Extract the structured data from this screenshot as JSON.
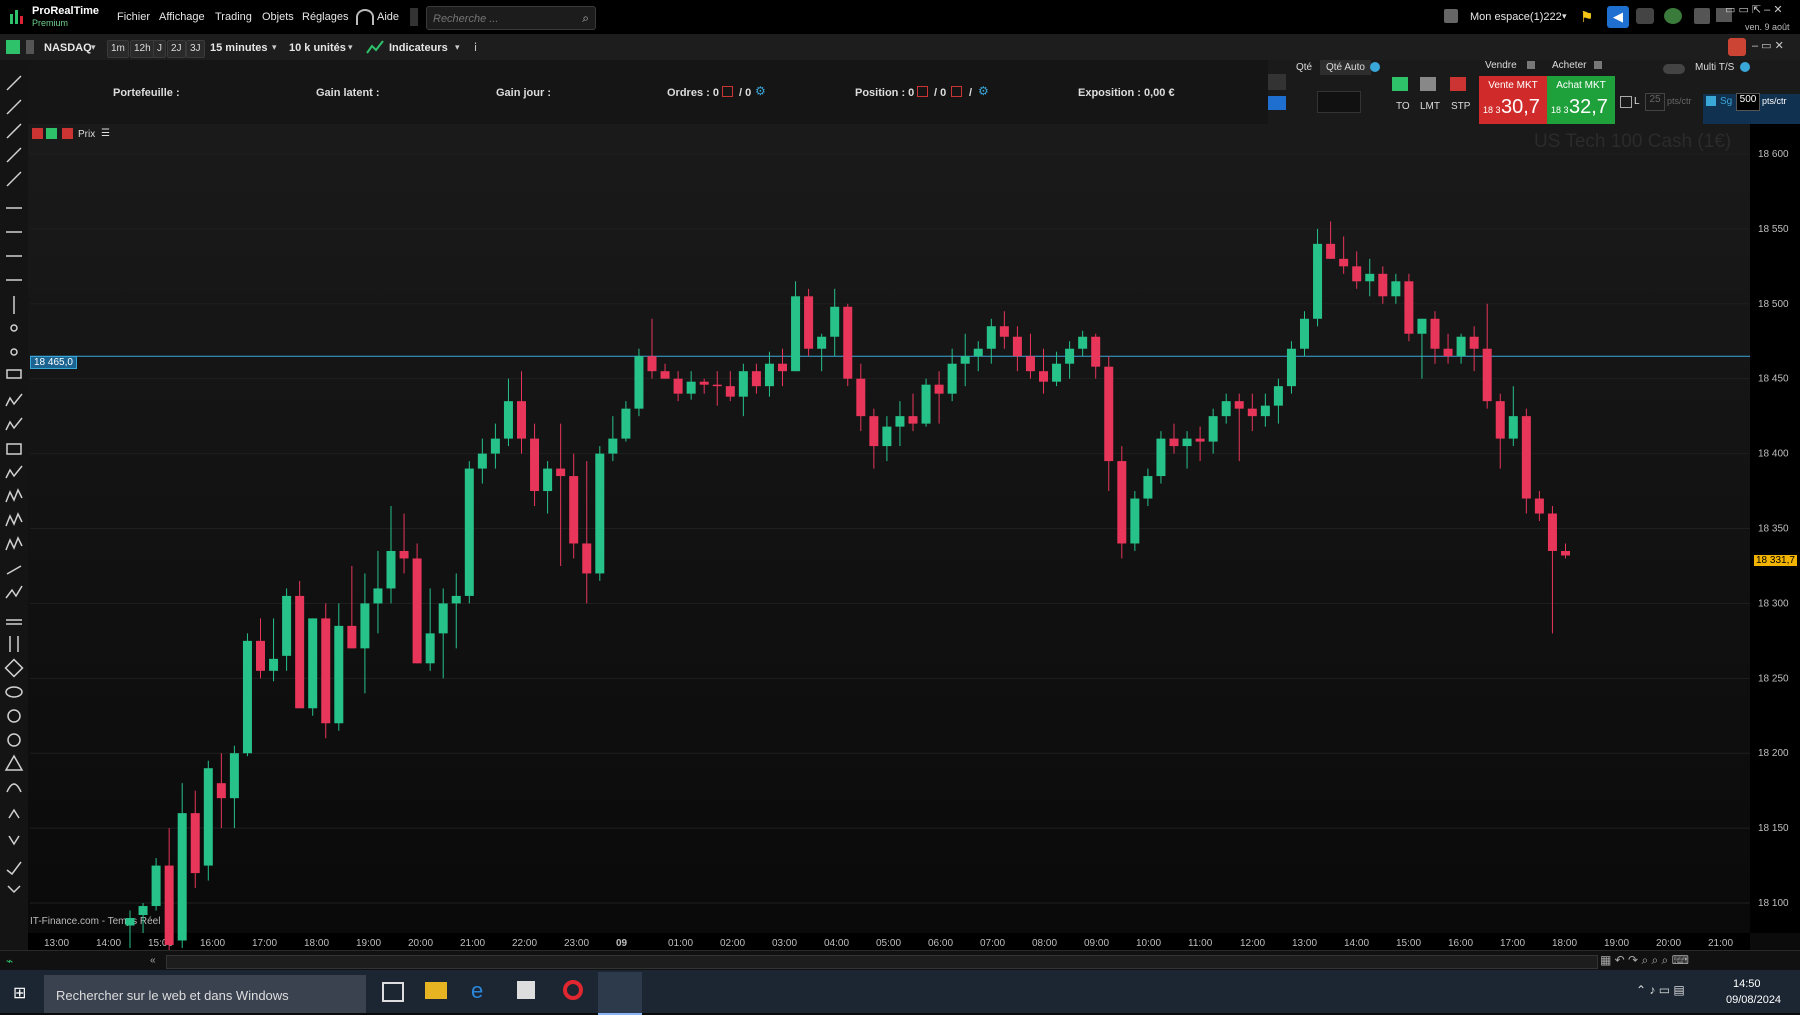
{
  "app": {
    "title": "ProRealTime",
    "subtitle": "Premium"
  },
  "menu": [
    "Fichier",
    "Affichage",
    "Trading",
    "Objets",
    "Réglages"
  ],
  "help_label": "Aide",
  "search": {
    "placeholder": "Recherche ..."
  },
  "workspace_label": "Mon espace(1)222",
  "date_top": "ven. 9 août",
  "toolbar": {
    "instrument": "NASDAQ",
    "periods": [
      "1m",
      "12h",
      "J",
      "2J",
      "3J"
    ],
    "timeframe": "15 minutes",
    "units": "10 k unités",
    "indicators_label": "Indicateurs"
  },
  "info": {
    "portefeuille": "Portefeuille :",
    "gain_latent": "Gain latent :",
    "gain_jour": "Gain jour :",
    "ordres": "Ordres : 0",
    "ordres_b": "/ 0",
    "position": "Position : 0",
    "position_b": "/ 0",
    "position_c": "/",
    "exposition": "Exposition : 0,00 €"
  },
  "trade": {
    "qty_label": "Qté",
    "qty_auto": "Qté Auto",
    "order_types": [
      "TO",
      "LMT",
      "STP"
    ],
    "sell_header": "Vendre",
    "buy_header": "Acheter",
    "sell_label": "Vente MKT",
    "buy_label": "Achat MKT",
    "sell_prefix": "18 3",
    "sell_price": "30,7",
    "buy_prefix": "18 3",
    "buy_price": "32,7",
    "multi_ts": "Multi T/S",
    "l_label": "L",
    "l_value": "25",
    "sg_label": "Sg",
    "sg_value": "500",
    "pts_ctr": "pts/ctr"
  },
  "chart_header": {
    "prix_label": "Prix",
    "watermark": "US Tech 100 Cash (1€)"
  },
  "source_label": "IT-Finance.com - Temps Réel",
  "hline_label": "18 465,0",
  "current_price_label": "18 331,7",
  "taskbar": {
    "search_text": "Rechercher sur le web et dans Windows",
    "time": "14:50",
    "date": "09/08/2024"
  },
  "colors": {
    "up": "#26c28a",
    "down": "#e8355a",
    "hline": "#3aa7d9"
  },
  "chart_data": {
    "type": "candlestick",
    "title": "US Tech 100 Cash (1€)",
    "ylim": [
      18080,
      18620
    ],
    "y_ticks": [
      18100,
      18150,
      18200,
      18250,
      18300,
      18350,
      18400,
      18450,
      18500,
      18550,
      18600
    ],
    "y_tick_labels": [
      "18 100",
      "18 150",
      "18 200",
      "18 250",
      "18 300",
      "18 350",
      "18 400",
      "18 450",
      "18 500",
      "18 550",
      "18 600"
    ],
    "x_tick_labels": [
      "13:00",
      "14:00",
      "15:00",
      "16:00",
      "17:00",
      "18:00",
      "19:00",
      "20:00",
      "21:00",
      "22:00",
      "23:00",
      "09",
      "01:00",
      "02:00",
      "03:00",
      "04:00",
      "05:00",
      "06:00",
      "07:00",
      "08:00",
      "09:00",
      "10:00",
      "11:00",
      "12:00",
      "13:00",
      "14:00",
      "15:00",
      "16:00",
      "17:00",
      "18:00",
      "19:00",
      "20:00",
      "21:00"
    ],
    "hline": 18465,
    "ohlc": [
      [
        18085,
        18095,
        18070,
        18090
      ],
      [
        18092,
        18100,
        18080,
        18098
      ],
      [
        18098,
        18130,
        18095,
        18125
      ],
      [
        18125,
        18150,
        18060,
        18072
      ],
      [
        18075,
        18180,
        18070,
        18160
      ],
      [
        18160,
        18175,
        18110,
        18120
      ],
      [
        18125,
        18195,
        18115,
        18190
      ],
      [
        18180,
        18200,
        18150,
        18170
      ],
      [
        18170,
        18205,
        18150,
        18200
      ],
      [
        18200,
        18280,
        18198,
        18275
      ],
      [
        18275,
        18290,
        18250,
        18255
      ],
      [
        18255,
        18290,
        18248,
        18263
      ],
      [
        18265,
        18310,
        18255,
        18305
      ],
      [
        18305,
        18315,
        18240,
        18230
      ],
      [
        18230,
        18290,
        18225,
        18290
      ],
      [
        18290,
        18300,
        18210,
        18220
      ],
      [
        18220,
        18300,
        18215,
        18285
      ],
      [
        18285,
        18325,
        18270,
        18270
      ],
      [
        18270,
        18320,
        18240,
        18300
      ],
      [
        18300,
        18335,
        18280,
        18310
      ],
      [
        18310,
        18365,
        18300,
        18335
      ],
      [
        18335,
        18360,
        18320,
        18330
      ],
      [
        18330,
        18340,
        18260,
        18260
      ],
      [
        18260,
        18310,
        18255,
        18280
      ],
      [
        18280,
        18310,
        18250,
        18300
      ],
      [
        18300,
        18320,
        18270,
        18305
      ],
      [
        18305,
        18395,
        18300,
        18390
      ],
      [
        18390,
        18410,
        18380,
        18400
      ],
      [
        18400,
        18420,
        18390,
        18410
      ],
      [
        18410,
        18450,
        18405,
        18435
      ],
      [
        18435,
        18455,
        18400,
        18410
      ],
      [
        18410,
        18420,
        18365,
        18375
      ],
      [
        18375,
        18395,
        18360,
        18390
      ],
      [
        18390,
        18420,
        18325,
        18385
      ],
      [
        18385,
        18400,
        18330,
        18340
      ],
      [
        18340,
        18395,
        18300,
        18320
      ],
      [
        18320,
        18405,
        18315,
        18400
      ],
      [
        18400,
        18425,
        18395,
        18410
      ],
      [
        18410,
        18435,
        18408,
        18430
      ],
      [
        18430,
        18470,
        18425,
        18465
      ],
      [
        18465,
        18490,
        18450,
        18455
      ],
      [
        18455,
        18460,
        18450,
        18450
      ],
      [
        18450,
        18455,
        18435,
        18440
      ],
      [
        18440,
        18455,
        18436,
        18448
      ],
      [
        18448,
        18450,
        18440,
        18446
      ],
      [
        18446,
        18455,
        18432,
        18445
      ],
      [
        18445,
        18455,
        18435,
        18438
      ],
      [
        18438,
        18460,
        18425,
        18455
      ],
      [
        18455,
        18460,
        18440,
        18445
      ],
      [
        18445,
        18468,
        18438,
        18460
      ],
      [
        18460,
        18470,
        18445,
        18455
      ],
      [
        18455,
        18515,
        18455,
        18505
      ],
      [
        18505,
        18510,
        18465,
        18470
      ],
      [
        18470,
        18480,
        18455,
        18478
      ],
      [
        18478,
        18510,
        18465,
        18498
      ],
      [
        18498,
        18500,
        18445,
        18450
      ],
      [
        18450,
        18460,
        18415,
        18425
      ],
      [
        18425,
        18430,
        18390,
        18405
      ],
      [
        18405,
        18425,
        18395,
        18418
      ],
      [
        18418,
        18435,
        18405,
        18425
      ],
      [
        18425,
        18440,
        18415,
        18420
      ],
      [
        18420,
        18450,
        18418,
        18446
      ],
      [
        18446,
        18455,
        18420,
        18440
      ],
      [
        18440,
        18470,
        18435,
        18460
      ],
      [
        18460,
        18480,
        18445,
        18465
      ],
      [
        18465,
        18475,
        18455,
        18470
      ],
      [
        18470,
        18490,
        18460,
        18485
      ],
      [
        18485,
        18495,
        18470,
        18478
      ],
      [
        18478,
        18485,
        18455,
        18465
      ],
      [
        18465,
        18480,
        18450,
        18455
      ],
      [
        18455,
        18470,
        18440,
        18448
      ],
      [
        18448,
        18468,
        18445,
        18460
      ],
      [
        18460,
        18475,
        18450,
        18470
      ],
      [
        18470,
        18482,
        18465,
        18478
      ],
      [
        18478,
        18480,
        18450,
        18458
      ],
      [
        18458,
        18465,
        18375,
        18395
      ],
      [
        18395,
        18405,
        18330,
        18340
      ],
      [
        18340,
        18375,
        18335,
        18370
      ],
      [
        18370,
        18390,
        18365,
        18385
      ],
      [
        18385,
        18415,
        18380,
        18410
      ],
      [
        18410,
        18420,
        18400,
        18405
      ],
      [
        18405,
        18415,
        18390,
        18410
      ],
      [
        18410,
        18418,
        18395,
        18408
      ],
      [
        18408,
        18430,
        18400,
        18425
      ],
      [
        18425,
        18440,
        18420,
        18435
      ],
      [
        18435,
        18440,
        18395,
        18430
      ],
      [
        18430,
        18440,
        18415,
        18425
      ],
      [
        18425,
        18440,
        18418,
        18432
      ],
      [
        18432,
        18450,
        18420,
        18445
      ],
      [
        18445,
        18475,
        18440,
        18470
      ],
      [
        18470,
        18495,
        18465,
        18490
      ],
      [
        18490,
        18550,
        18485,
        18540
      ],
      [
        18540,
        18555,
        18530,
        18530
      ],
      [
        18530,
        18545,
        18520,
        18525
      ],
      [
        18525,
        18535,
        18510,
        18515
      ],
      [
        18515,
        18530,
        18505,
        18520
      ],
      [
        18520,
        18525,
        18500,
        18505
      ],
      [
        18505,
        18520,
        18500,
        18515
      ],
      [
        18515,
        18520,
        18475,
        18480
      ],
      [
        18480,
        18490,
        18450,
        18490
      ],
      [
        18490,
        18495,
        18460,
        18470
      ],
      [
        18470,
        18480,
        18460,
        18465
      ],
      [
        18465,
        18480,
        18460,
        18478
      ],
      [
        18478,
        18485,
        18455,
        18470
      ],
      [
        18470,
        18500,
        18430,
        18435
      ],
      [
        18435,
        18440,
        18390,
        18410
      ],
      [
        18410,
        18445,
        18405,
        18425
      ],
      [
        18425,
        18430,
        18360,
        18370
      ],
      [
        18370,
        18375,
        18355,
        18360
      ],
      [
        18360,
        18365,
        18280,
        18335
      ],
      [
        18335,
        18340,
        18330,
        18332
      ]
    ]
  }
}
